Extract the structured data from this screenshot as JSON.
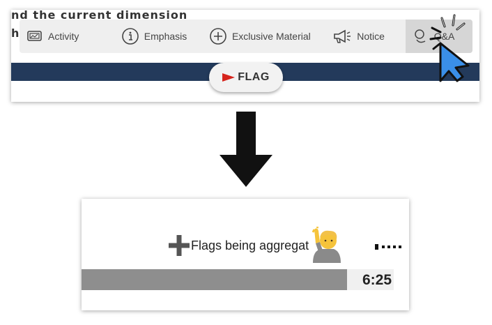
{
  "top_panel": {
    "background_lines": [
      "nd the current dimension",
      "h"
    ],
    "toolbar": {
      "items": [
        {
          "label": "Activity",
          "icon": "activity-icon"
        },
        {
          "label": "Emphasis",
          "icon": "info-circle-icon"
        },
        {
          "label": "Exclusive Material",
          "icon": "plus-circle-icon"
        },
        {
          "label": "Notice",
          "icon": "megaphone-icon"
        },
        {
          "label": "Q&A",
          "icon": "qa-icon"
        }
      ],
      "hovered": "Q&A"
    },
    "flag_button": {
      "label": "FLAG",
      "icon": "flag-icon"
    },
    "colors": {
      "nav_bar": "#233a5b",
      "flag": "#d6241c",
      "cursor": "#3a8fe8"
    }
  },
  "bottom_panel": {
    "status_text": "Flags being aggregat",
    "icons": [
      "plus-icon",
      "person-raising-hand-icon",
      "dotted-line-icon"
    ],
    "progress_fraction": 0.85,
    "time": "6:25"
  }
}
